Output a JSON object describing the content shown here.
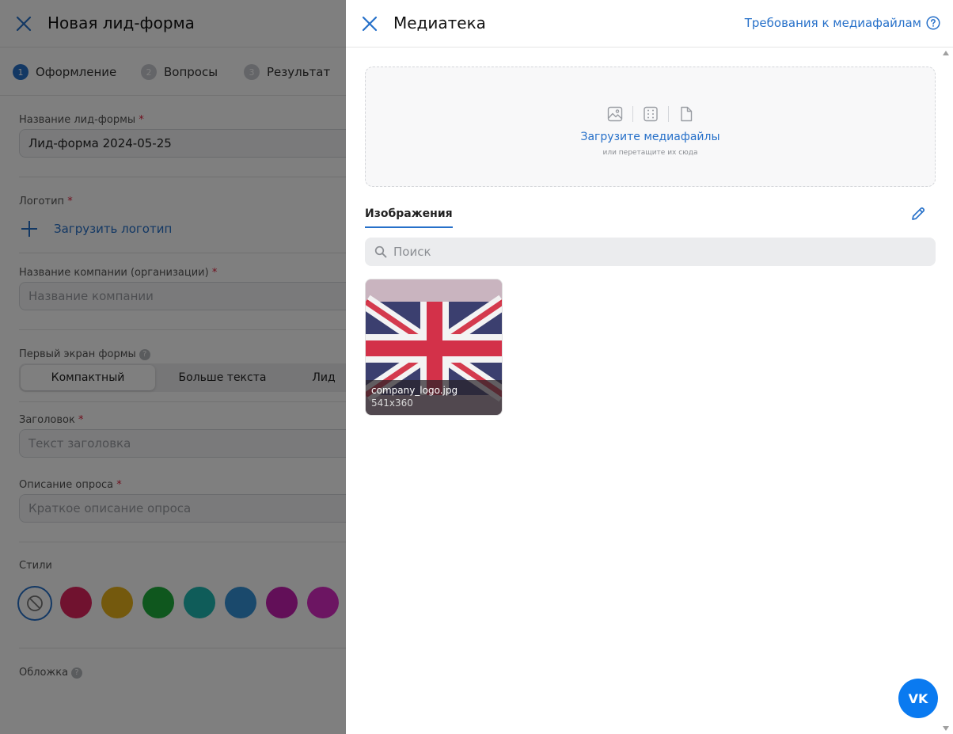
{
  "form": {
    "title": "Новая лид-форма",
    "steps": [
      {
        "num": "1",
        "label": "Оформление"
      },
      {
        "num": "2",
        "label": "Вопросы"
      },
      {
        "num": "3",
        "label": "Результат"
      }
    ],
    "name_label": "Название лид-формы",
    "name_value": "Лид-форма 2024-05-25",
    "logo_label": "Логотип",
    "upload_logo": "Загрузить логотип",
    "company_label": "Название компании (организации)",
    "company_placeholder": "Название компании",
    "first_screen_label": "Первый экран формы",
    "first_screen_options": [
      "Компактный",
      "Больше текста",
      "Лид"
    ],
    "headline_label": "Заголовок",
    "headline_placeholder": "Текст заголовка",
    "description_label": "Описание опроса",
    "description_placeholder": "Краткое описание опроса",
    "styles_label": "Стили",
    "style_colors": [
      "#e0245e",
      "#e8b21a",
      "#1fae3c",
      "#1fb8b2",
      "#3592d8",
      "#c41fb0",
      "#d92ac4"
    ],
    "cover_label": "Обложка",
    "required_mark": "*",
    "help_mark": "?"
  },
  "panel": {
    "title": "Медиатека",
    "requirements_link": "Требования к медиафайлам",
    "dropzone": {
      "main": "Загрузите медиафайлы",
      "sub": "или перетащите их сюда"
    },
    "tab_images": "Изображения",
    "search_placeholder": "Поиск",
    "media": [
      {
        "filename": "company_logo.jpg",
        "dimensions": "541x360"
      }
    ]
  },
  "vk_label": "VK",
  "colors": {
    "accent": "#2670c9",
    "vk_blue": "#0a7af0"
  }
}
